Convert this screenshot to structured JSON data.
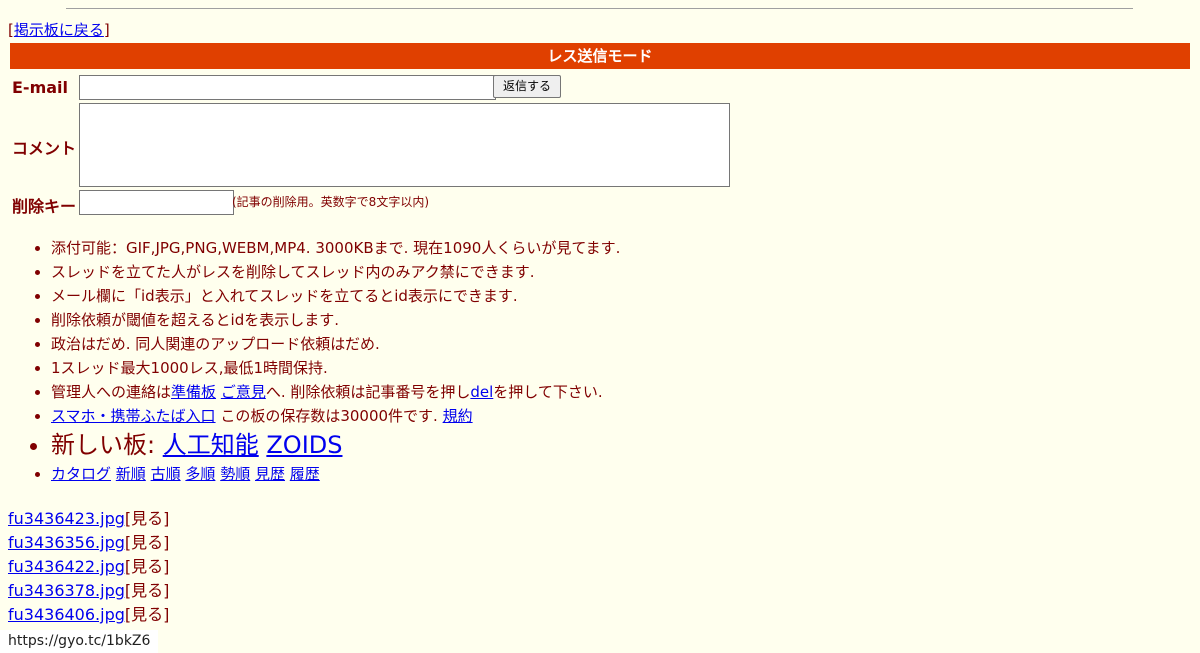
{
  "header": {
    "back_open": "[",
    "back_link": "掲示板に戻る",
    "back_close": "]",
    "mode_title": "レス送信モード"
  },
  "form": {
    "email_label": "E-mail",
    "email_value": "",
    "reply_button": "返信する",
    "comment_label": "コメント",
    "comment_value": "",
    "delkey_label": "削除キー",
    "delkey_value": "",
    "delkey_note": "(記事の削除用。英数字で8文字以内)"
  },
  "notes": {
    "n1": "添付可能：GIF,JPG,PNG,WEBM,MP4. 3000KBまで. 現在1090人くらいが見てます.",
    "n2": "スレッドを立てた人がレスを削除してスレッド内のみアク禁にできます.",
    "n3": "メール欄に「id表示」と入れてスレッドを立てるとid表示にできます.",
    "n4": "削除依頼が閾値を超えるとidを表示します.",
    "n5": "政治はだめ. 同人関連のアップロード依頼はだめ.",
    "n6": "1スレッド最大1000レス,最低1時間保持.",
    "n7": {
      "prefix": "管理人への連絡は",
      "link1": "準備板",
      "sep": " ",
      "link2": "ご意見",
      "middle": "へ. 削除依頼は記事番号を押し",
      "link3": "del",
      "suffix": "を押して下さい."
    },
    "n8": {
      "link1": "スマホ・携帯ふたば入口",
      "middle": " この板の保存数は30000件です. ",
      "link2": "規約"
    },
    "n9": {
      "prefix": "新しい板: ",
      "link1": "人工知能",
      "link2": "ZOIDS"
    },
    "n10": [
      "カタログ",
      "新順",
      "古順",
      "多順",
      "勢順",
      "見歴",
      "履歴"
    ]
  },
  "files": [
    {
      "name": "fu3436423.jpg",
      "action": "[見る]"
    },
    {
      "name": "fu3436356.jpg",
      "action": "[見る]"
    },
    {
      "name": "fu3436422.jpg",
      "action": "[見る]"
    },
    {
      "name": "fu3436378.jpg",
      "action": "[見る]"
    },
    {
      "name": "fu3436406.jpg",
      "action": "[見る]"
    }
  ],
  "status_url": "https://gyo.tc/1bkZ6"
}
